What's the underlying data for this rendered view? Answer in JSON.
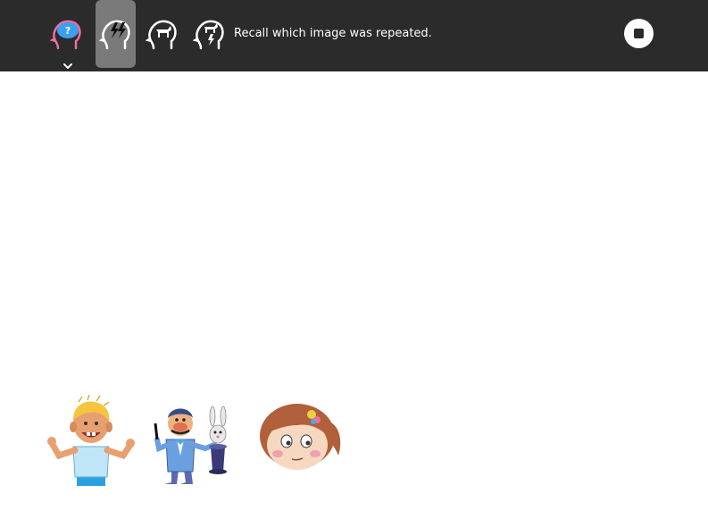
{
  "toolbar": {
    "modes": [
      {
        "name": "mode-question",
        "icon": "head-question-icon",
        "active": false
      },
      {
        "name": "mode-lightning",
        "icon": "head-lightning-icon",
        "active": true
      },
      {
        "name": "mode-horse",
        "icon": "head-horse-icon",
        "active": false
      },
      {
        "name": "mode-horse-lightning",
        "icon": "head-horse-lightning-icon",
        "active": false
      }
    ],
    "instruction": "Recall which image was repeated.",
    "stop_icon": "stop-icon"
  },
  "choices": [
    {
      "name": "boy-arms-open",
      "icon": "boy-illustration"
    },
    {
      "name": "magician-with-rabbit",
      "icon": "magician-illustration"
    },
    {
      "name": "girl-face",
      "icon": "girl-face-illustration"
    }
  ],
  "colors": {
    "toolbar_bg": "#2b2b2b",
    "active_mode_bg": "#7a7a7a",
    "question_brain": "#3a9ff0",
    "accent_pink": "#f06ca0"
  }
}
